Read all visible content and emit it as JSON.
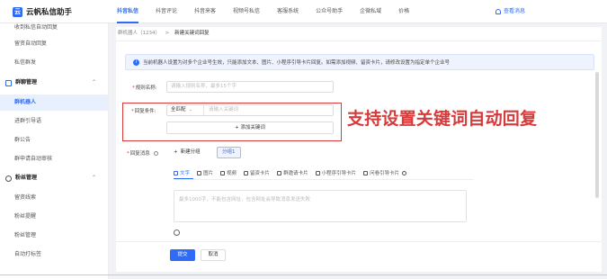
{
  "app": {
    "title": "云帆私信助手"
  },
  "top_nav": {
    "items": [
      "抖音私信",
      "抖音评论",
      "抖音来客",
      "视频号私信",
      "客服系统",
      "公众号助手",
      "企微私域",
      "价格"
    ],
    "notify": "查看消息"
  },
  "sidebar": {
    "items_top": [
      "收到私信自动回复",
      "留资自动回复",
      "私信群发"
    ],
    "group1": {
      "label": "群聊管理",
      "items": [
        "群机器人",
        "进群引导语",
        "群公告",
        "群申请自动审核"
      ]
    },
    "group2": {
      "label": "粉丝管理",
      "items": [
        "留资线索",
        "粉丝提醒",
        "粉丝管理",
        "自动打标签"
      ]
    }
  },
  "breadcrumb": {
    "parent": "群机器人（1234）",
    "sep": ">",
    "current": "新建关键词回复"
  },
  "alert": {
    "text": "当前机器人设置为对多个企业号生效，只能添加文本、图片、小程序引导卡片回复。如需添加视频、留资卡片，请修改设置为指定单个企业号"
  },
  "form": {
    "rule_name": {
      "label": "规则名称:",
      "placeholder": "请输入规则名称，最多15个字"
    },
    "condition": {
      "label": "回复条件:",
      "match": "全匹配",
      "keyword_placeholder": "请输入关键词",
      "add_button": "+ 添加关键词"
    },
    "reply": {
      "label": "回复消息",
      "new_group": "新建分组",
      "group_tag": "分组1",
      "tabs": [
        "文字",
        "图片",
        "视频",
        "留资卡片",
        "群邀请卡片",
        "小程序引导卡片",
        "问卷引导卡片"
      ],
      "textarea_placeholder": "最多1000字，不能包含网址，包含网址会导致消息发送失败"
    }
  },
  "callout": {
    "text": "支持设置关键词自动回复"
  },
  "footer": {
    "submit": "提交",
    "cancel": "取消"
  },
  "colors": {
    "accent": "#2f6cf6",
    "annotation": "#d63a3a"
  }
}
